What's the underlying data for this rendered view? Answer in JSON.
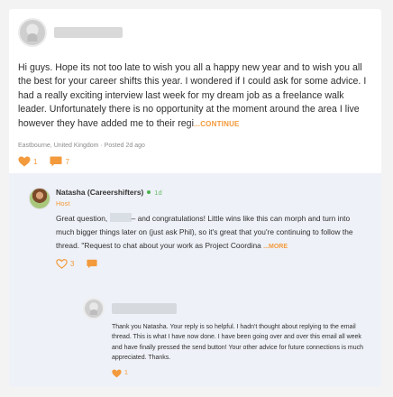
{
  "post": {
    "body": "Hi guys. Hope its not too late to wish you all a happy new year and to wish you all the best for your career shifts this year. I wondered if I could ask for some advice. I had a really exciting interview last week for my dream job as a freelance walk leader. Unfortunately there is no opportunity at the moment around the area I live however they have added me to their regi",
    "continue_label": "...CONTINUE",
    "location": "Eastbourne, United Kingdom",
    "separator": " · ",
    "posted": "Posted 2d ago",
    "likes": "1",
    "comments": "7"
  },
  "reply": {
    "name": "Natasha (Careershifters)",
    "time": "1d",
    "role": "Host",
    "body_before": "Great question, ",
    "body_after": "– and congratulations! Little wins like this can morph and turn into much bigger things later on (just ask Phil), so it's great that you're continuing to follow the thread. \"Request to chat about your work as Project Coordina",
    "more_label": "...MORE",
    "likes": "3"
  },
  "nested_reply": {
    "body": "Thank you Natasha. Your reply is so helpful. I hadn't thought about replying to the email thread. This is what I have now done. I have been going over and over this email all week and have finally pressed the send button! Your other advice for future connections is much appreciated. Thanks.",
    "likes": "1"
  },
  "icons": {
    "heart": "heart-icon",
    "comment": "comment-icon",
    "accent": "#f39a3c"
  }
}
